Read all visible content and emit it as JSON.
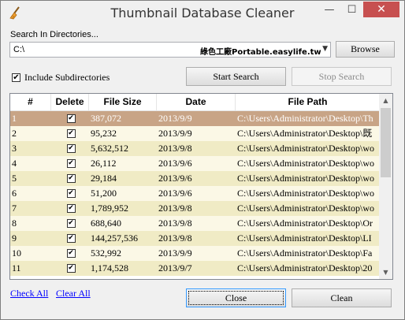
{
  "window": {
    "title": "Thumbnail Database Cleaner",
    "controls": {
      "minimize": "—",
      "maximize": "☐",
      "close": "✕"
    }
  },
  "search": {
    "label": "Search In Directories...",
    "directory": "C:\\",
    "watermark": "綠色工廠Portable.easylife.tw",
    "browse_label": "Browse",
    "include_subdirs_label": "Include Subdirectories",
    "include_subdirs_checked": true,
    "start_label": "Start Search",
    "stop_label": "Stop Search"
  },
  "table": {
    "columns": [
      "#",
      "Delete",
      "File Size",
      "Date",
      "File Path"
    ],
    "rows": [
      {
        "num": "1",
        "delete": true,
        "size": "387,072",
        "date": "2013/9/9",
        "path": "C:\\Users\\Administrator\\Desktop\\Th",
        "selected": true
      },
      {
        "num": "2",
        "delete": true,
        "size": "95,232",
        "date": "2013/9/9",
        "path": "C:\\Users\\Administrator\\Desktop\\既"
      },
      {
        "num": "3",
        "delete": true,
        "size": "5,632,512",
        "date": "2013/9/8",
        "path": "C:\\Users\\Administrator\\Desktop\\wo"
      },
      {
        "num": "4",
        "delete": true,
        "size": "26,112",
        "date": "2013/9/6",
        "path": "C:\\Users\\Administrator\\Desktop\\wo"
      },
      {
        "num": "5",
        "delete": true,
        "size": "29,184",
        "date": "2013/9/6",
        "path": "C:\\Users\\Administrator\\Desktop\\wo"
      },
      {
        "num": "6",
        "delete": true,
        "size": "51,200",
        "date": "2013/9/6",
        "path": "C:\\Users\\Administrator\\Desktop\\wo"
      },
      {
        "num": "7",
        "delete": true,
        "size": "1,789,952",
        "date": "2013/9/8",
        "path": "C:\\Users\\Administrator\\Desktop\\wo"
      },
      {
        "num": "8",
        "delete": true,
        "size": "688,640",
        "date": "2013/9/8",
        "path": "C:\\Users\\Administrator\\Desktop\\Or"
      },
      {
        "num": "9",
        "delete": true,
        "size": "144,257,536",
        "date": "2013/9/8",
        "path": "C:\\Users\\Administrator\\Desktop\\LI"
      },
      {
        "num": "10",
        "delete": true,
        "size": "532,992",
        "date": "2013/9/9",
        "path": "C:\\Users\\Administrator\\Desktop\\Fa"
      },
      {
        "num": "11",
        "delete": true,
        "size": "1,174,528",
        "date": "2013/9/7",
        "path": "C:\\Users\\Administrator\\Desktop\\20"
      }
    ]
  },
  "footer": {
    "check_all": "Check All",
    "clear_all": "Clear All",
    "close_label": "Close",
    "clean_label": "Clean"
  },
  "icons": {
    "app": "broom-icon",
    "check": "✔",
    "scroll_up": "▲",
    "scroll_down": "▼",
    "dropdown": "▼"
  },
  "colors": {
    "selected_row": "#c8a486",
    "odd_row": "#f0ebc5",
    "even_row": "#fbf8e6",
    "link": "#0000ff",
    "close_button": "#c75050"
  }
}
